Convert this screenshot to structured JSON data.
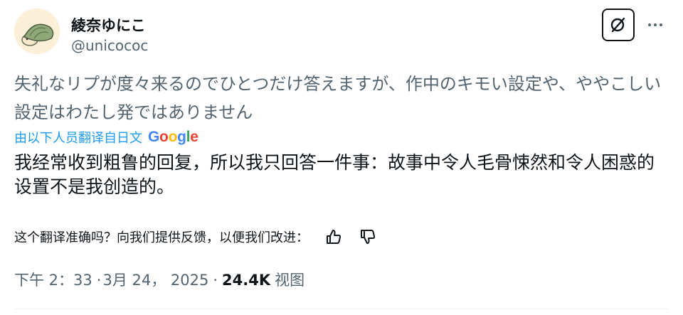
{
  "author": {
    "name": "綾奈ゆにこ",
    "handle": "@unicococ"
  },
  "post": {
    "original_text": "失礼なリプが度々来るのでひとつだけ答えますが、作中のキモい設定や、ややこしい設定はわたし発ではありません",
    "translated_by_label": "由以下人员翻译自日文",
    "translator_brand": "Google",
    "translated_text": "我经常收到粗鲁的回复，所以我只回答一件事：故事中令人毛骨悚然和令人困惑的设置不是我创造的。",
    "feedback_prompt": "这个翻译准确吗？向我们提供反馈，以便我们改进："
  },
  "meta": {
    "time": "下午 2：33",
    "separator1": "·",
    "date": "3月 24， 2025",
    "separator2": "·",
    "views_count": "24.4K",
    "views_label": "视图"
  },
  "icons": {
    "grok": "grok-icon",
    "more": "more-icon",
    "thumb_up": "thumbs-up-icon",
    "thumb_down": "thumbs-down-icon",
    "avatar": "turtle-avatar"
  }
}
